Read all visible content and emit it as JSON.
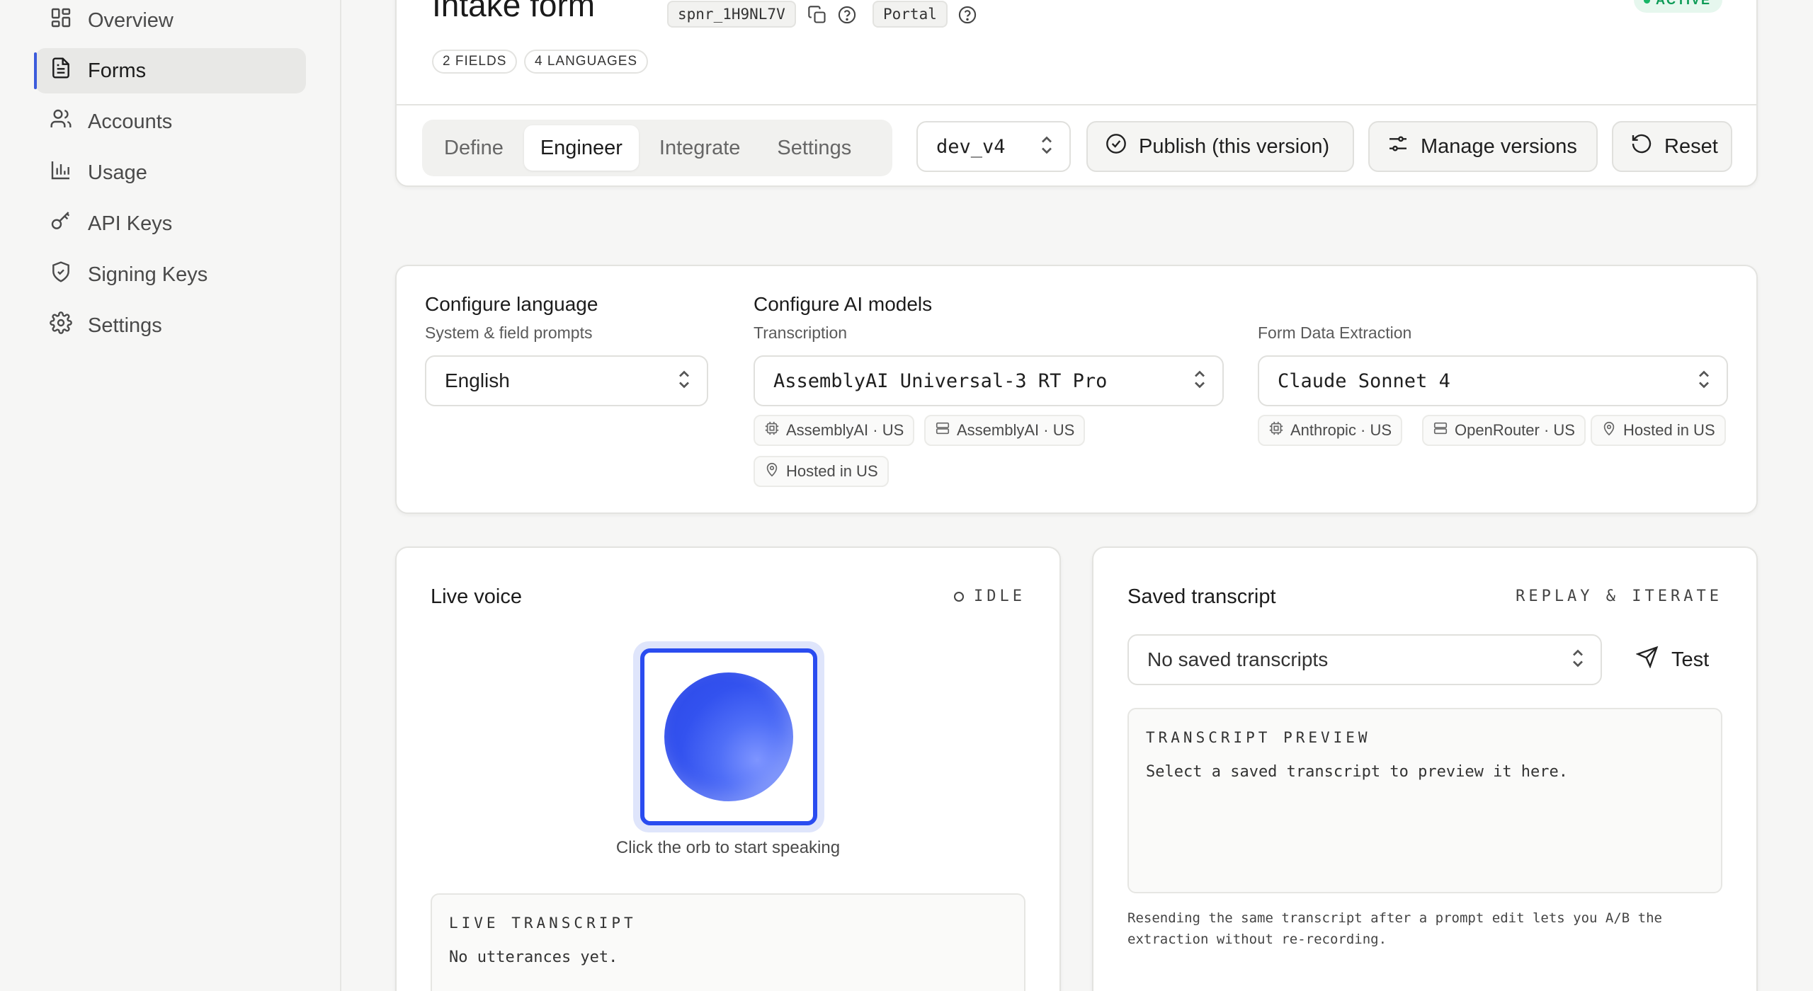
{
  "sidebar": {
    "items": [
      {
        "label": "Overview",
        "icon": "layout-grid-icon"
      },
      {
        "label": "Forms",
        "icon": "file-text-icon"
      },
      {
        "label": "Accounts",
        "icon": "users-icon"
      },
      {
        "label": "Usage",
        "icon": "bar-chart-icon"
      },
      {
        "label": "API Keys",
        "icon": "key-icon"
      },
      {
        "label": "Signing Keys",
        "icon": "shield-check-icon"
      },
      {
        "label": "Settings",
        "icon": "gear-icon"
      }
    ]
  },
  "header": {
    "title": "Intake form",
    "form_id": "spnr_1H9NL7V",
    "portal_label": "Portal",
    "status": "ACTIVE",
    "status_color": "#16b566",
    "meta": [
      "2 FIELDS",
      "4 LANGUAGES"
    ]
  },
  "toolbar": {
    "tabs": [
      "Define",
      "Engineer",
      "Integrate",
      "Settings"
    ],
    "active_tab": "Engineer",
    "version_value": "dev_v4",
    "publish_label": "Publish (this version)",
    "manage_label": "Manage versions",
    "reset_label": "Reset"
  },
  "config": {
    "language": {
      "title": "Configure language",
      "subtitle": "System & field prompts",
      "value": "English"
    },
    "models": {
      "title": "Configure AI models",
      "transcription": {
        "label": "Transcription",
        "value": "AssemblyAI Universal-3 RT Pro",
        "tags": [
          {
            "label": "AssemblyAI · US",
            "icon": "chip-icon"
          },
          {
            "label": "AssemblyAI · US",
            "icon": "server-icon"
          },
          {
            "label": "Hosted in US",
            "icon": "map-pin-icon"
          }
        ]
      },
      "extraction": {
        "label": "Form Data Extraction",
        "value": "Claude Sonnet 4",
        "tags": [
          {
            "label": "Anthropic · US",
            "icon": "chip-icon"
          },
          {
            "label": "OpenRouter · US",
            "icon": "server-icon"
          },
          {
            "label": "Hosted in US",
            "icon": "map-pin-icon"
          }
        ]
      }
    }
  },
  "live_voice": {
    "title": "Live voice",
    "status": "IDLE",
    "orb_caption": "Click the orb to start speaking",
    "transcript_title": "LIVE TRANSCRIPT",
    "transcript_empty": "No utterances yet.",
    "accent": "#2a4cf0"
  },
  "saved_transcript": {
    "title": "Saved transcript",
    "subtitle": "REPLAY & ITERATE",
    "select_value": "No saved transcripts",
    "test_label": "Test",
    "preview_title": "TRANSCRIPT PREVIEW",
    "preview_body": "Select a saved transcript to preview it here.",
    "note": "Resending the same transcript after a prompt edit lets you A/B the extraction without re-recording."
  }
}
